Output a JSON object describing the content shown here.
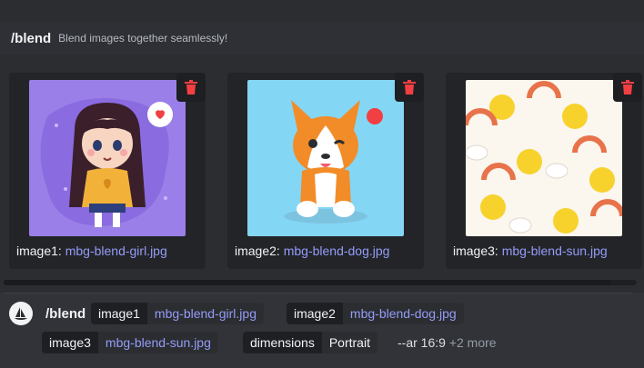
{
  "command": {
    "name": "/blend",
    "description": "Blend images together seamlessly!"
  },
  "images": [
    {
      "key": "image1:",
      "file": "mbg-blend-girl.jpg"
    },
    {
      "key": "image2:",
      "file": "mbg-blend-dog.jpg"
    },
    {
      "key": "image3:",
      "file": "mbg-blend-sun.jpg"
    }
  ],
  "composer": {
    "command": "/blend",
    "options": [
      {
        "name": "image1",
        "value": "mbg-blend-girl.jpg"
      },
      {
        "name": "image2",
        "value": "mbg-blend-dog.jpg"
      },
      {
        "name": "image3",
        "value": "mbg-blend-sun.jpg"
      },
      {
        "name": "dimensions",
        "value": "Portrait"
      }
    ],
    "extra_text": "--ar 16:9",
    "more_label": "+2 more"
  },
  "colors": {
    "accent_link": "#949cf7",
    "trash_red": "#f23f43"
  }
}
